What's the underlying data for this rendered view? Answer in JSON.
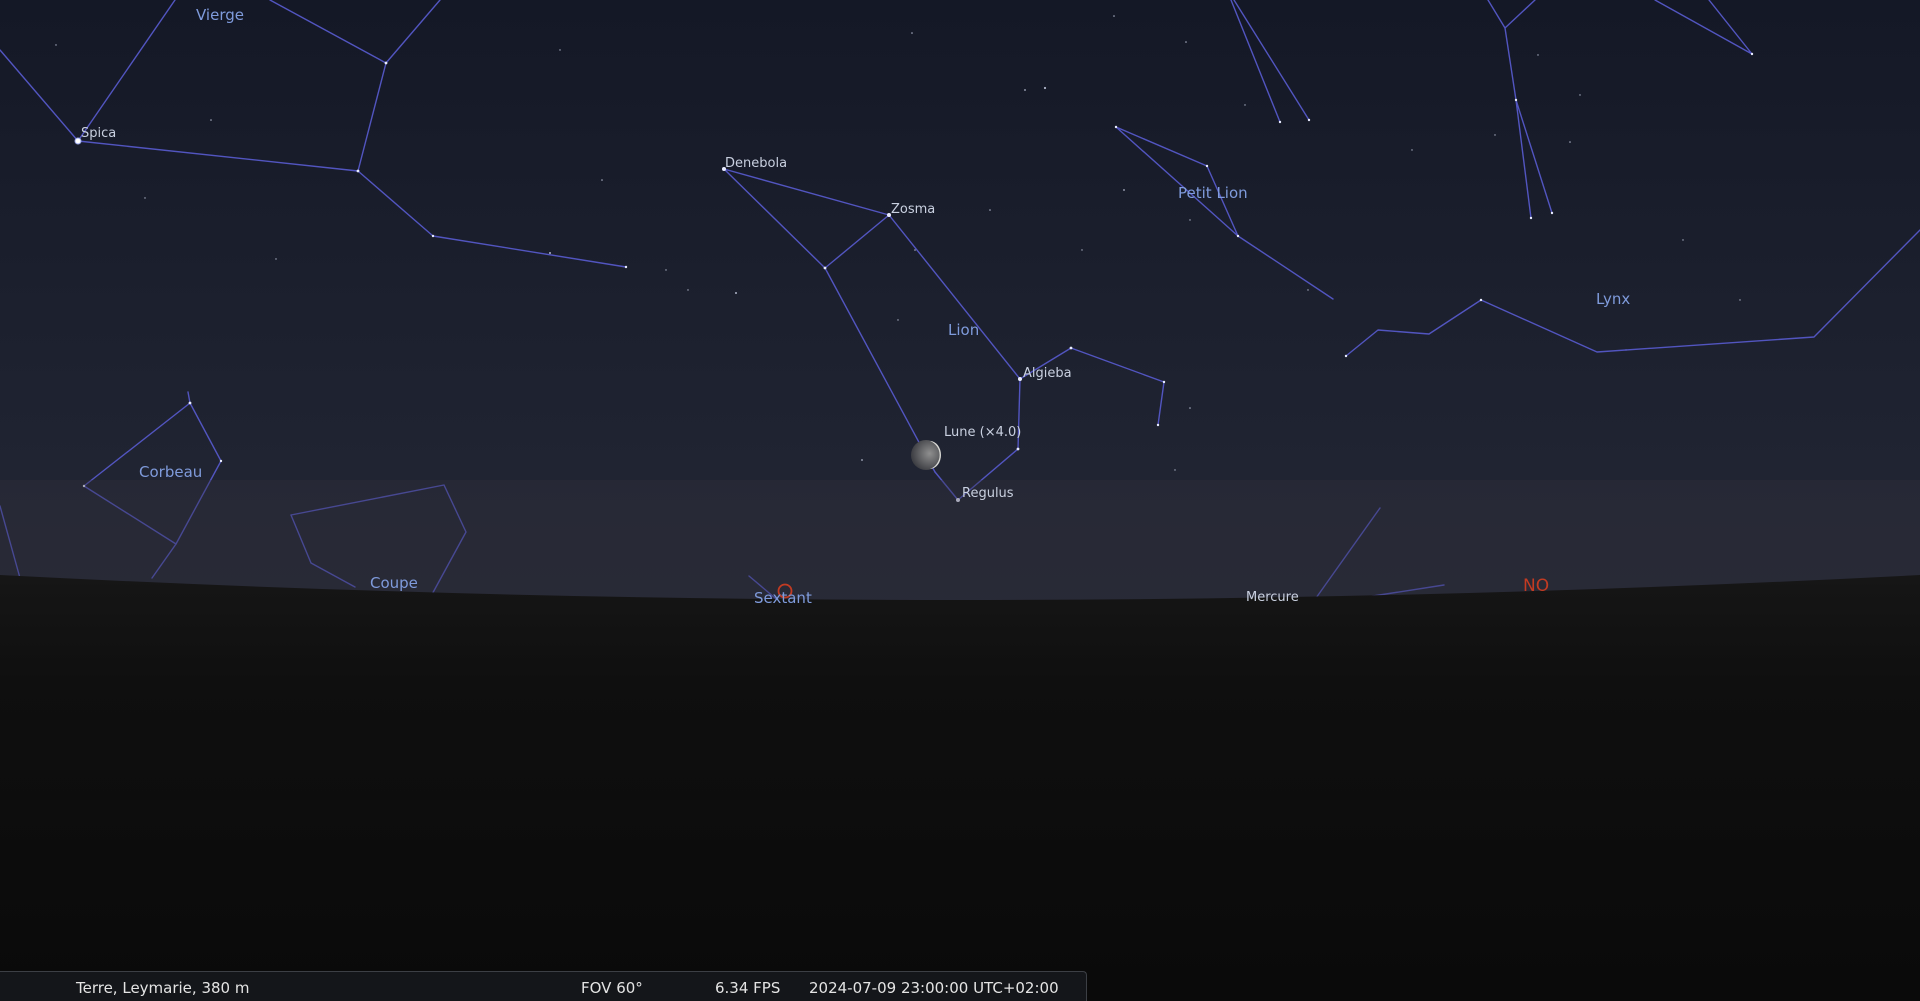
{
  "colors": {
    "constellation_line": "#5255c0",
    "constellation_label": "#7f9bdc",
    "star_label": "#c9d0e0",
    "star": "#e8ecff",
    "cardinal": "#c33b22",
    "ground": "#0c0c0c",
    "sky_top": "#141826",
    "sky_horizon": "#2c2c38"
  },
  "constellations": [
    {
      "name": "Vierge"
    },
    {
      "name": "Corbeau"
    },
    {
      "name": "Coupe"
    },
    {
      "name": "Lion"
    },
    {
      "name": "Petit Lion"
    },
    {
      "name": "Lynx"
    },
    {
      "name": "Sextant"
    }
  ],
  "stars": [
    {
      "name": "Spica"
    },
    {
      "name": "Denebola"
    },
    {
      "name": "Zosma"
    },
    {
      "name": "Algieba"
    },
    {
      "name": "Regulus"
    }
  ],
  "planets": [
    {
      "name": "Mercure"
    }
  ],
  "moon": {
    "label": "Lune (×4.0)"
  },
  "cardinal": {
    "label": "NO"
  },
  "status_bar": {
    "location": "Terre, Leymarie, 380 m",
    "fov": "FOV 60°",
    "fps": "6.34 FPS",
    "datetime": "2024-07-09 23:00:00 UTC+02:00"
  }
}
